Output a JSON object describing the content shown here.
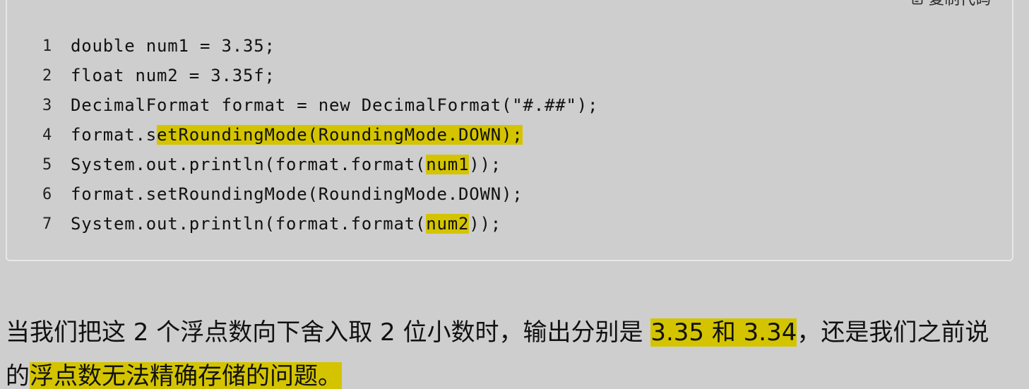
{
  "copy_button": {
    "icon": "clipboard-icon",
    "label": "复制代码"
  },
  "code": {
    "lines": [
      {
        "number": "1",
        "parts": [
          {
            "text": "double num1 = 3.35;",
            "highlight": false
          }
        ]
      },
      {
        "number": "2",
        "parts": [
          {
            "text": "float num2 = 3.35f;",
            "highlight": false
          }
        ]
      },
      {
        "number": "3",
        "parts": [
          {
            "text": "DecimalFormat format = new DecimalFormat(\"#.##\");",
            "highlight": false
          }
        ]
      },
      {
        "number": "4",
        "parts": [
          {
            "text": "format.s",
            "highlight": false
          },
          {
            "text": "etRoundingMode(RoundingMode.DOWN);",
            "highlight": true
          }
        ]
      },
      {
        "number": "5",
        "parts": [
          {
            "text": "System.out.println(format.format(",
            "highlight": false
          },
          {
            "text": "num1",
            "highlight": true
          },
          {
            "text": "));",
            "highlight": false
          }
        ]
      },
      {
        "number": "6",
        "parts": [
          {
            "text": "format.setRoundingMode(RoundingMode.DOWN);",
            "highlight": false
          }
        ]
      },
      {
        "number": "7",
        "parts": [
          {
            "text": "System.out.println(format.format(",
            "highlight": false
          },
          {
            "text": "num2",
            "highlight": true
          },
          {
            "text": "));",
            "highlight": false
          }
        ]
      }
    ]
  },
  "paragraph": {
    "parts": [
      {
        "text": "当我们把这 2 个浮点数向下舍入取 2 位小数时，输出分别是 ",
        "highlight": false
      },
      {
        "text": "3.35 和 3.34",
        "highlight": true
      },
      {
        "text": "，还是我们之前说的",
        "highlight": false
      },
      {
        "text": "浮点数无法精确存储的问题。",
        "highlight": true
      }
    ]
  },
  "colors": {
    "background": "#cecece",
    "highlight": "#d4c400",
    "border": "#e8e8e8"
  }
}
